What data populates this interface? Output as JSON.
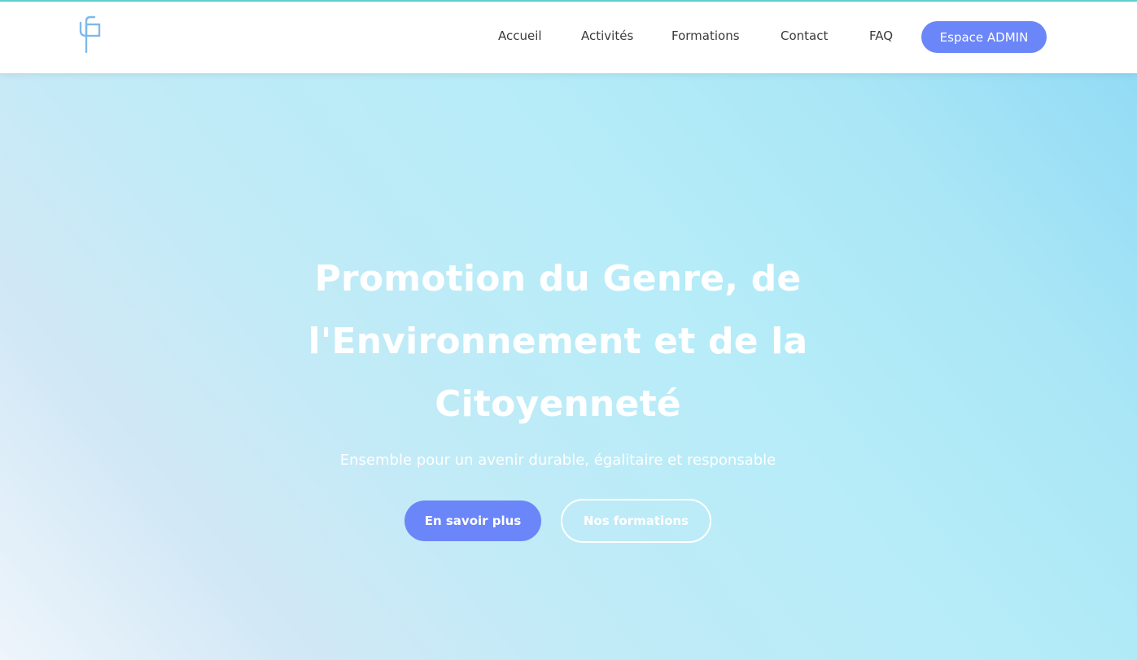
{
  "header": {
    "logo_icon": "gp-monogram-logo-icon",
    "nav": {
      "accueil": "Accueil",
      "activites": "Activités",
      "formations": "Formations",
      "contact": "Contact",
      "faq": "FAQ"
    },
    "admin_button": "Espace ADMIN"
  },
  "hero": {
    "title_line1": "Promotion du Genre, de",
    "title_line2": "l'Environnement et de la",
    "title_line3": "Citoyenneté",
    "subtitle": "Ensemble pour un avenir durable, égalitaire et responsable",
    "primary_button": "En savoir plus",
    "secondary_button": "Nos formations"
  },
  "colors": {
    "accent": "#6b86f8",
    "top_border": "#5fd3d0",
    "logo": "#7fb8ec",
    "hero_gradient_start": "#eef5fb",
    "hero_gradient_end": "#93dbf5"
  }
}
